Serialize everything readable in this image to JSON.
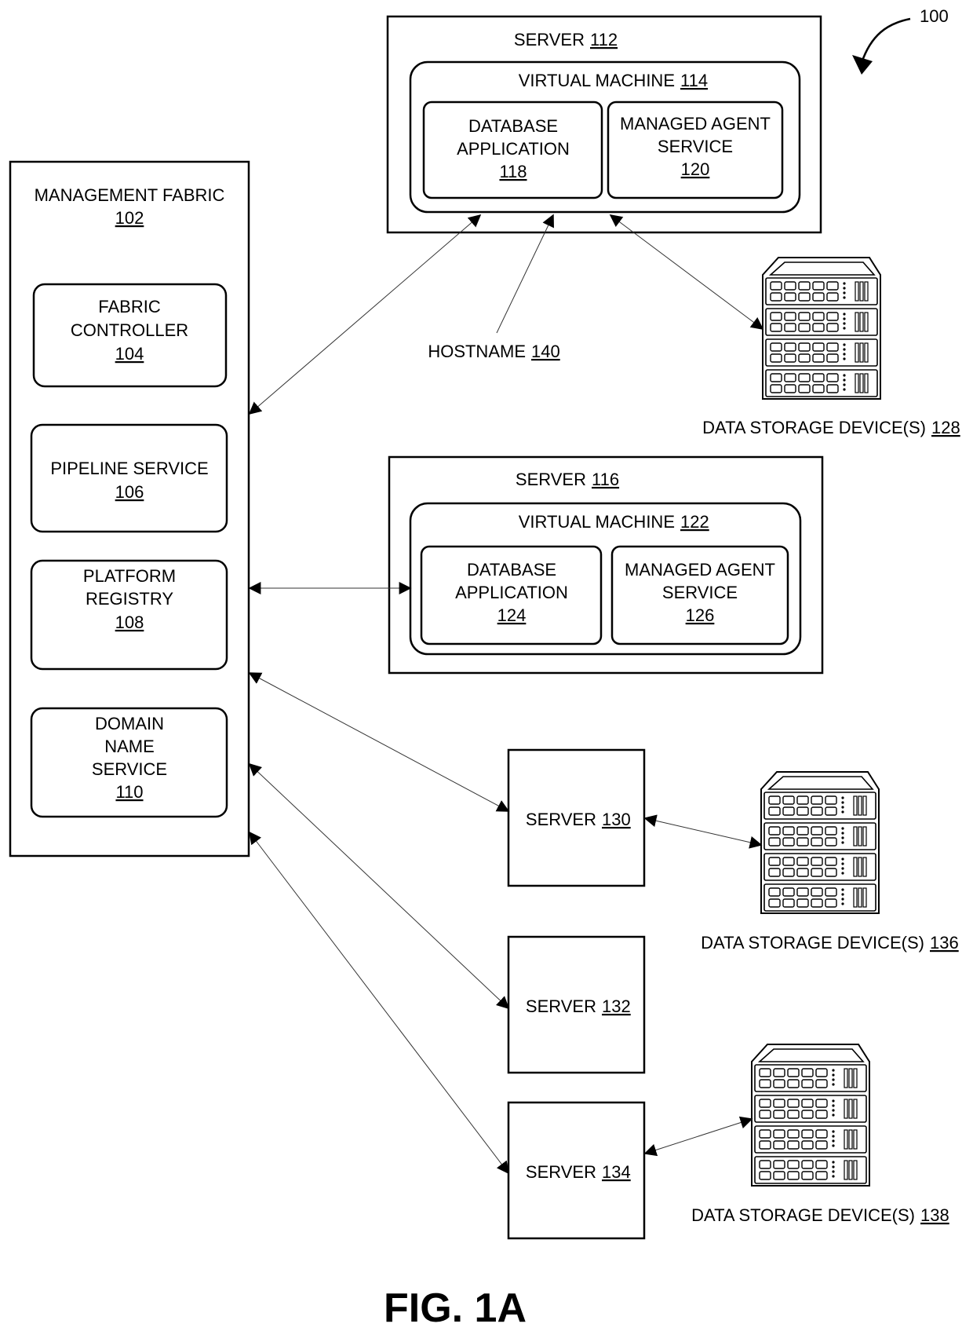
{
  "figure": {
    "reference_number": "100",
    "caption": "FIG. 1A"
  },
  "management_fabric": {
    "label": "MANAGEMENT FABRIC",
    "number": "102",
    "components": [
      {
        "lines": [
          "FABRIC",
          "CONTROLLER"
        ],
        "number": "104"
      },
      {
        "lines": [
          "PIPELINE SERVICE"
        ],
        "number": "106"
      },
      {
        "lines": [
          "PLATFORM",
          "REGISTRY"
        ],
        "number": "108"
      },
      {
        "lines": [
          "DOMAIN",
          "NAME",
          "SERVICE"
        ],
        "number": "110"
      }
    ]
  },
  "server_112": {
    "label": "SERVER",
    "number": "112",
    "vm": {
      "label": "VIRTUAL MACHINE",
      "number": "114"
    },
    "db_app": {
      "lines": [
        "DATABASE",
        "APPLICATION"
      ],
      "number": "118"
    },
    "agent": {
      "lines": [
        "MANAGED AGENT",
        "SERVICE"
      ],
      "number": "120"
    }
  },
  "server_116": {
    "label": "SERVER",
    "number": "116",
    "vm": {
      "label": "VIRTUAL MACHINE",
      "number": "122"
    },
    "db_app": {
      "lines": [
        "DATABASE",
        "APPLICATION"
      ],
      "number": "124"
    },
    "agent": {
      "lines": [
        "MANAGED AGENT",
        "SERVICE"
      ],
      "number": "126"
    }
  },
  "hostname": {
    "label": "HOSTNAME",
    "number": "140"
  },
  "servers": [
    {
      "label": "SERVER",
      "number": "130"
    },
    {
      "label": "SERVER",
      "number": "132"
    },
    {
      "label": "SERVER",
      "number": "134"
    }
  ],
  "storage": [
    {
      "label": "DATA STORAGE DEVICE(S)",
      "number": "128",
      "icon": "server-rack-icon"
    },
    {
      "label": "DATA STORAGE DEVICE(S)",
      "number": "136",
      "icon": "server-rack-icon"
    },
    {
      "label": "DATA STORAGE DEVICE(S)",
      "number": "138",
      "icon": "server-rack-icon"
    }
  ]
}
